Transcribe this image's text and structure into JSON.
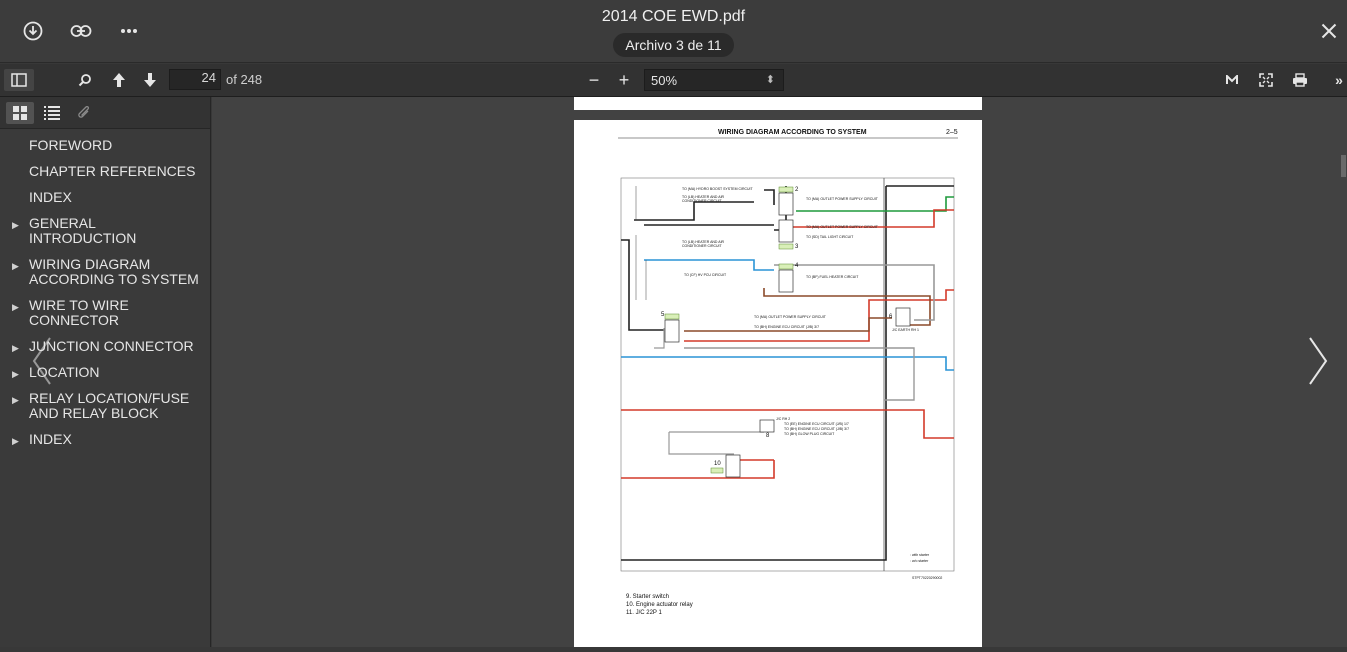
{
  "header": {
    "file_title": "2014 COE EWD.pdf",
    "file_counter": "Archivo 3 de 11",
    "download_icon": "download-icon",
    "link_icon": "link-icon",
    "more_icon": "more-icon",
    "close_icon": "close-icon"
  },
  "toolbar": {
    "page_number": "24",
    "page_total": "of 248",
    "zoom_out": "−",
    "zoom_in": "+",
    "zoom_value": "50%"
  },
  "sidebar": {
    "outline": [
      {
        "label": "FOREWORD",
        "expandable": false
      },
      {
        "label": "CHAPTER REFERENCES",
        "expandable": false
      },
      {
        "label": "INDEX",
        "expandable": false
      },
      {
        "label": "GENERAL INTRODUCTION",
        "expandable": true
      },
      {
        "label": "WIRING DIAGRAM ACCORDING TO SYSTEM",
        "expandable": true
      },
      {
        "label": "WIRE TO WIRE CONNECTOR",
        "expandable": true
      },
      {
        "label": "JUNCTION CONNECTOR",
        "expandable": true
      },
      {
        "label": "LOCATION",
        "expandable": true
      },
      {
        "label": "RELAY LOCATION/FUSE AND RELAY BLOCK",
        "expandable": true
      },
      {
        "label": "INDEX",
        "expandable": true
      }
    ]
  },
  "document": {
    "heading": "WIRING DIAGRAM ACCORDING TO SYSTEM",
    "page_ref": "2–5",
    "doc_code": "STPT70220290002",
    "legend": [
      "9.   Starter switch",
      "10.  Engine actuator relay",
      "11.  J/C 22P 1"
    ],
    "labels": {
      "l1": "TO (MA) HYDRO BOOST SYSTEM CIRCUIT",
      "l2": "TO (LB) HEATER AND AIR CONDITIONER CIRCUIT",
      "l3": "TO (MA) OUTLET POWER SUPPLY CIRCUIT",
      "l4": "TO (MA) OUTLET POWER SUPPLY CIRCUIT",
      "l5": "TO (SD) TAIL LIGHT CIRCUIT",
      "l6": "TO (LB) HEATER AND AIR CONDITIONER CIRCUIT",
      "l7": "TO (CF) HV PCU CIRCUIT",
      "l8": "TO (BF) FUEL HEATER CIRCUIT",
      "l9": "TO (MA) OUTLET POWER SUPPLY CIRCUIT",
      "l10": "TO (BH) ENGINE ECU CIRCUIT (J/B) 3/7",
      "l11": "J/C EARTH RH 1",
      "l12": "J/C RH 2",
      "l13": "TO (EE) ENGINE ECU CIRCUIT (J/B) 1/7",
      "l14": "TO (BH) ENGINE ECU CIRCUIT (J/B) 3/7",
      "l15": "TO (BH) GLOW PLUG CIRCUIT",
      "l16": ": with starter",
      "l17": ": w/o starter"
    },
    "numbers": [
      "2",
      "3",
      "4",
      "5",
      "6",
      "8",
      "10"
    ]
  }
}
